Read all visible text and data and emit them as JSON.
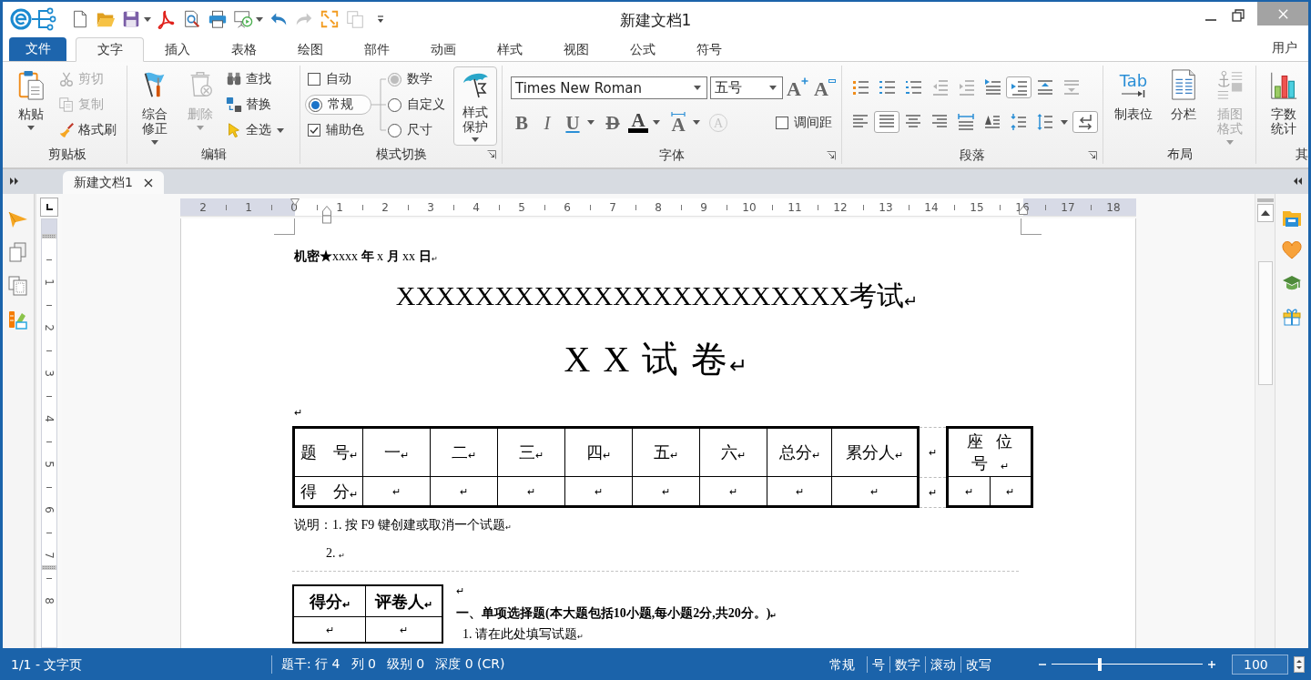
{
  "window": {
    "title": "新建文档1"
  },
  "quick_access": [
    {
      "kind": "new",
      "disabled": false,
      "dropdown": false
    },
    {
      "kind": "open",
      "disabled": false,
      "dropdown": false
    },
    {
      "kind": "save",
      "disabled": false,
      "dropdown": true
    },
    {
      "kind": "pdf",
      "disabled": false,
      "dropdown": false
    },
    {
      "kind": "preview",
      "disabled": false,
      "dropdown": false
    },
    {
      "kind": "print",
      "disabled": false,
      "dropdown": false
    },
    {
      "kind": "present",
      "disabled": false,
      "dropdown": true
    },
    {
      "kind": "undo",
      "disabled": false,
      "dropdown": false
    },
    {
      "kind": "redo",
      "disabled": true,
      "dropdown": false
    },
    {
      "kind": "fullscreen",
      "disabled": false,
      "dropdown": false
    },
    {
      "kind": "duplicate",
      "disabled": true,
      "dropdown": false
    }
  ],
  "menu_tabs": [
    {
      "label": "文件",
      "kind": "file",
      "selected": false
    },
    {
      "label": "文字",
      "kind": "tab",
      "selected": true
    },
    {
      "label": "插入",
      "kind": "tab",
      "selected": false
    },
    {
      "label": "表格",
      "kind": "tab",
      "selected": false
    },
    {
      "label": "绘图",
      "kind": "tab",
      "selected": false
    },
    {
      "label": "部件",
      "kind": "tab",
      "selected": false
    },
    {
      "label": "动画",
      "kind": "tab",
      "selected": false
    },
    {
      "label": "样式",
      "kind": "tab",
      "selected": false
    },
    {
      "label": "视图",
      "kind": "tab",
      "selected": false
    },
    {
      "label": "公式",
      "kind": "tab",
      "selected": false
    },
    {
      "label": "符号",
      "kind": "tab",
      "selected": false
    }
  ],
  "user_menu": "用户",
  "ribbon": [
    {
      "kind": "clipboard",
      "label": "剪贴板",
      "launcher": false,
      "large": {
        "label": "粘贴",
        "dropdown": true
      },
      "small": [
        {
          "label": "剪切",
          "disabled": true
        },
        {
          "label": "复制",
          "disabled": true
        },
        {
          "label": "格式刷",
          "disabled": false
        }
      ]
    },
    {
      "kind": "edit",
      "label": "编辑",
      "launcher": false,
      "large": [
        {
          "label": "综合修正",
          "disabled": false,
          "dropdown": true
        },
        {
          "label": "删除",
          "disabled": true,
          "dropdown": true
        }
      ],
      "small": [
        {
          "label": "查找",
          "dropdown": false
        },
        {
          "label": "替换",
          "dropdown": false
        },
        {
          "label": "全选",
          "dropdown": true
        }
      ]
    },
    {
      "kind": "mode",
      "label": "模式切换",
      "launcher": true,
      "options": [
        {
          "kind": "checkbox",
          "label": "自动",
          "checked": false
        },
        {
          "kind": "radio",
          "label": "常规",
          "selected": true
        },
        {
          "kind": "checkbox",
          "label": "辅助色",
          "checked": true
        }
      ],
      "sub_options": [
        {
          "label": "数学",
          "selected": true,
          "disabled": true
        },
        {
          "label": "自定义",
          "selected": false,
          "disabled": false
        },
        {
          "label": "尺寸",
          "selected": false,
          "disabled": false
        }
      ],
      "large": {
        "label": "样式保护",
        "dropdown": true
      }
    },
    {
      "kind": "font",
      "label": "字体",
      "launcher": true,
      "font_name": "Times New Roman",
      "font_size": "五号",
      "size_buttons": [
        {
          "kind": "grow",
          "glyph": "A"
        },
        {
          "kind": "shrink",
          "glyph": "A"
        }
      ],
      "format_buttons": [
        {
          "kind": "bold",
          "glyph": "B",
          "disabled": false,
          "dropdown": false
        },
        {
          "kind": "italic",
          "glyph": "I",
          "disabled": false,
          "dropdown": false
        },
        {
          "kind": "underline",
          "glyph": "U",
          "disabled": false,
          "dropdown": true
        },
        {
          "kind": "strike",
          "glyph": "D",
          "disabled": false,
          "dropdown": false
        },
        {
          "kind": "color",
          "glyph": "A",
          "disabled": false,
          "dropdown": true,
          "color": "#000000"
        },
        {
          "kind": "spacing",
          "glyph": "A",
          "disabled": false,
          "dropdown": true
        },
        {
          "kind": "enclose",
          "glyph": "A",
          "disabled": true,
          "dropdown": false
        }
      ],
      "spacing_check": {
        "label": "调间距",
        "checked": false
      }
    },
    {
      "kind": "paragraph",
      "label": "段落",
      "launcher": true,
      "rows": [
        [
          {
            "kind": "bullets",
            "on": false,
            "disabled": false,
            "dropdown": false
          },
          {
            "kind": "numbering",
            "on": false,
            "disabled": false,
            "dropdown": false
          },
          {
            "kind": "multilevel",
            "on": false,
            "disabled": false,
            "dropdown": false
          },
          {
            "kind": "outdent",
            "on": false,
            "disabled": true,
            "dropdown": false
          },
          {
            "kind": "indent",
            "on": false,
            "disabled": true,
            "dropdown": false
          },
          {
            "kind": "firstline",
            "on": false,
            "disabled": false,
            "dropdown": false
          },
          {
            "kind": "hanging",
            "on": true,
            "disabled": false,
            "dropdown": false
          },
          {
            "kind": "before",
            "on": false,
            "disabled": false,
            "dropdown": false
          },
          {
            "kind": "after",
            "on": false,
            "disabled": true,
            "dropdown": false
          }
        ],
        [
          {
            "kind": "left",
            "on": false,
            "disabled": false,
            "dropdown": false
          },
          {
            "kind": "justify",
            "on": true,
            "disabled": false,
            "dropdown": false
          },
          {
            "kind": "center",
            "on": false,
            "disabled": false,
            "dropdown": false
          },
          {
            "kind": "right",
            "on": false,
            "disabled": false,
            "dropdown": false
          },
          {
            "kind": "distribute",
            "on": false,
            "disabled": false,
            "dropdown": false
          },
          {
            "kind": "scale",
            "on": false,
            "disabled": false,
            "dropdown": false
          },
          {
            "kind": "compact",
            "on": false,
            "disabled": false,
            "dropdown": false
          },
          {
            "kind": "spacing",
            "on": false,
            "disabled": false,
            "dropdown": true
          },
          {
            "kind": "marks",
            "on": true,
            "disabled": false,
            "dropdown": false
          }
        ]
      ]
    },
    {
      "kind": "layout",
      "label": "布局",
      "launcher": false,
      "large": [
        {
          "kind": "tabstop",
          "label": "制表位",
          "icon_text": "Tab",
          "disabled": false,
          "dropdown": false
        },
        {
          "kind": "columns",
          "label": "分栏",
          "disabled": false,
          "dropdown": false
        },
        {
          "kind": "picture",
          "label": "插图格式",
          "disabled": true,
          "dropdown": true
        }
      ]
    },
    {
      "kind": "more",
      "label": "其",
      "launcher": false,
      "large": [
        {
          "kind": "wordcount",
          "label": "字数统计",
          "disabled": false,
          "dropdown": false
        }
      ]
    }
  ],
  "doc_tabs": [
    {
      "label": "新建文档1",
      "selected": true
    }
  ],
  "ruler": {
    "horizontal": [
      "2",
      "1",
      "0",
      "1",
      "2",
      "3",
      "4",
      "5",
      "6",
      "7",
      "8",
      "9",
      "10",
      "11",
      "12",
      "13",
      "14",
      "15",
      "16",
      "17",
      "18"
    ],
    "vertical": [
      "1",
      "2",
      "3",
      "4",
      "5",
      "6",
      "7",
      "8"
    ]
  },
  "document": {
    "header_line": "**机密★**xxxx **年** x **月** xx **日**$_{↵}$",
    "exam_title": "XXXXXXXXXXXXXXXXXXXXXXX考试$_{↵}$",
    "paper_title": "X X 试 卷$_{↵}$",
    "empty_paragraph": "↵",
    "score_table": {
      "rows": [
        [
          "题　号$_{↵}$",
          "一$_{↵}$",
          "二$_{↵}$",
          "三$_{↵}$",
          "四$_{↵}$",
          "五$_{↵}$",
          "六$_{↵}$",
          "总分$_{↵}$",
          "累分人$_{↵}$"
        ],
        [
          "得　分$_{↵}$",
          "↵",
          "↵",
          "↵",
          "↵",
          "↵",
          "↵",
          "↵",
          "↵"
        ]
      ]
    },
    "spacer_column": [
      "↵",
      "↵"
    ],
    "seat_table": {
      "header": "座位号$_{↵}$",
      "cells": [
        "↵",
        "↵"
      ]
    },
    "notes": [
      "说明：1. 按 F9 键创建或取消一个试题$_{↵}$",
      "2. $_{↵}$"
    ],
    "grader_table": {
      "header": [
        "得分$_{↵}$",
        "评卷人$_{↵}$"
      ],
      "cells": [
        "↵",
        "↵"
      ]
    },
    "section_mark": "↵",
    "section_title": "一、单项选择题(本大题包括10小题,每小题2分,共20分。)$_{↵}$",
    "questions": [
      "1. 请在此处填写试题$_{↵}$"
    ]
  },
  "status_bar": {
    "page_info": "1/1 - 文字页",
    "fields": [
      "题干: 行 4",
      "列 0",
      "级别 0",
      "深度 0 (CR)"
    ],
    "indicators": [
      "常规",
      "号",
      "数字",
      "滚动",
      "改写"
    ],
    "zoom": {
      "level": 0.32,
      "value": "100"
    }
  }
}
